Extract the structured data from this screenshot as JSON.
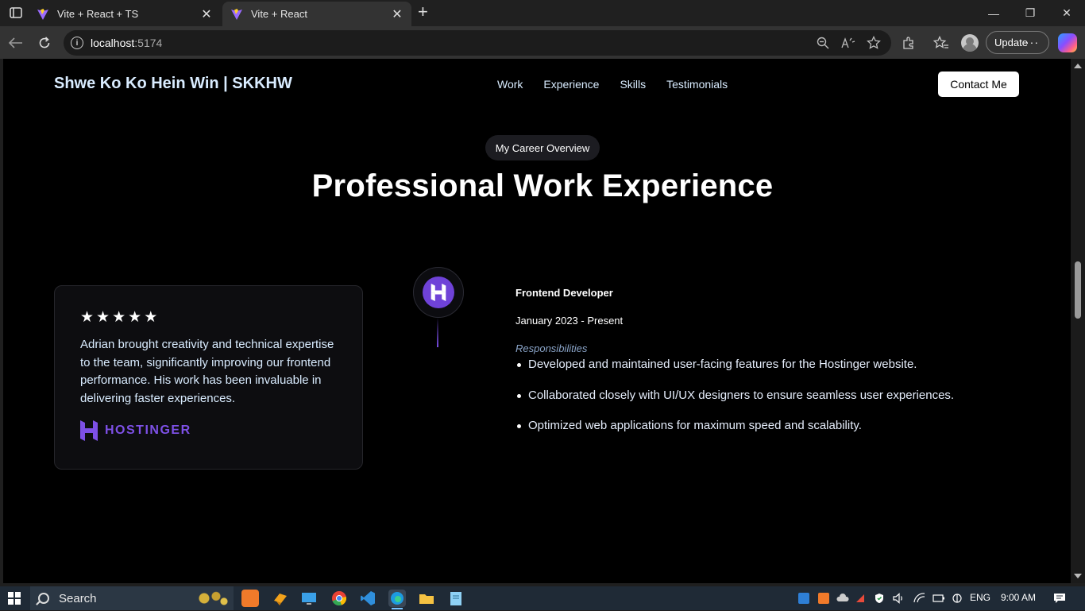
{
  "browser": {
    "tabs": [
      {
        "title": "Vite + React + TS",
        "close": "✕"
      },
      {
        "title": "Vite + React",
        "close": "✕"
      }
    ],
    "new_tab": "+",
    "window_controls": {
      "minimize": "—",
      "maximize": "❐",
      "close": "✕"
    },
    "address": {
      "host": "localhost",
      "port": ":5174"
    },
    "update_label": "Update",
    "more_label": "···"
  },
  "site": {
    "brand": "Shwe Ko Ko Hein Win | SKKHW",
    "nav": [
      "Work",
      "Experience",
      "Skills",
      "Testimonials"
    ],
    "contact_label": "Contact Me",
    "section_pill": "My Career Overview",
    "section_title": "Professional Work Experience",
    "review": {
      "rating": 5,
      "stars": [
        "★",
        "★",
        "★",
        "★",
        "★"
      ],
      "text": "Adrian brought creativity and technical expertise to the team, significantly improving our frontend performance. His work has been invaluable in delivering faster experiences.",
      "company": "HOSTINGER"
    },
    "experience": {
      "role": "Frontend Developer",
      "dates": "January 2023 - Present",
      "responsibilities_label": "Responsibilities",
      "responsibilities": [
        "Developed and maintained user-facing features for the Hostinger website.",
        "Collaborated closely with UI/UX designers to ensure seamless user experiences.",
        "Optimized web applications for maximum speed and scalability."
      ]
    },
    "accent_color": "#6f42d8"
  },
  "taskbar": {
    "search_placeholder": "Search",
    "language": "ENG",
    "time": "9:00 AM"
  }
}
